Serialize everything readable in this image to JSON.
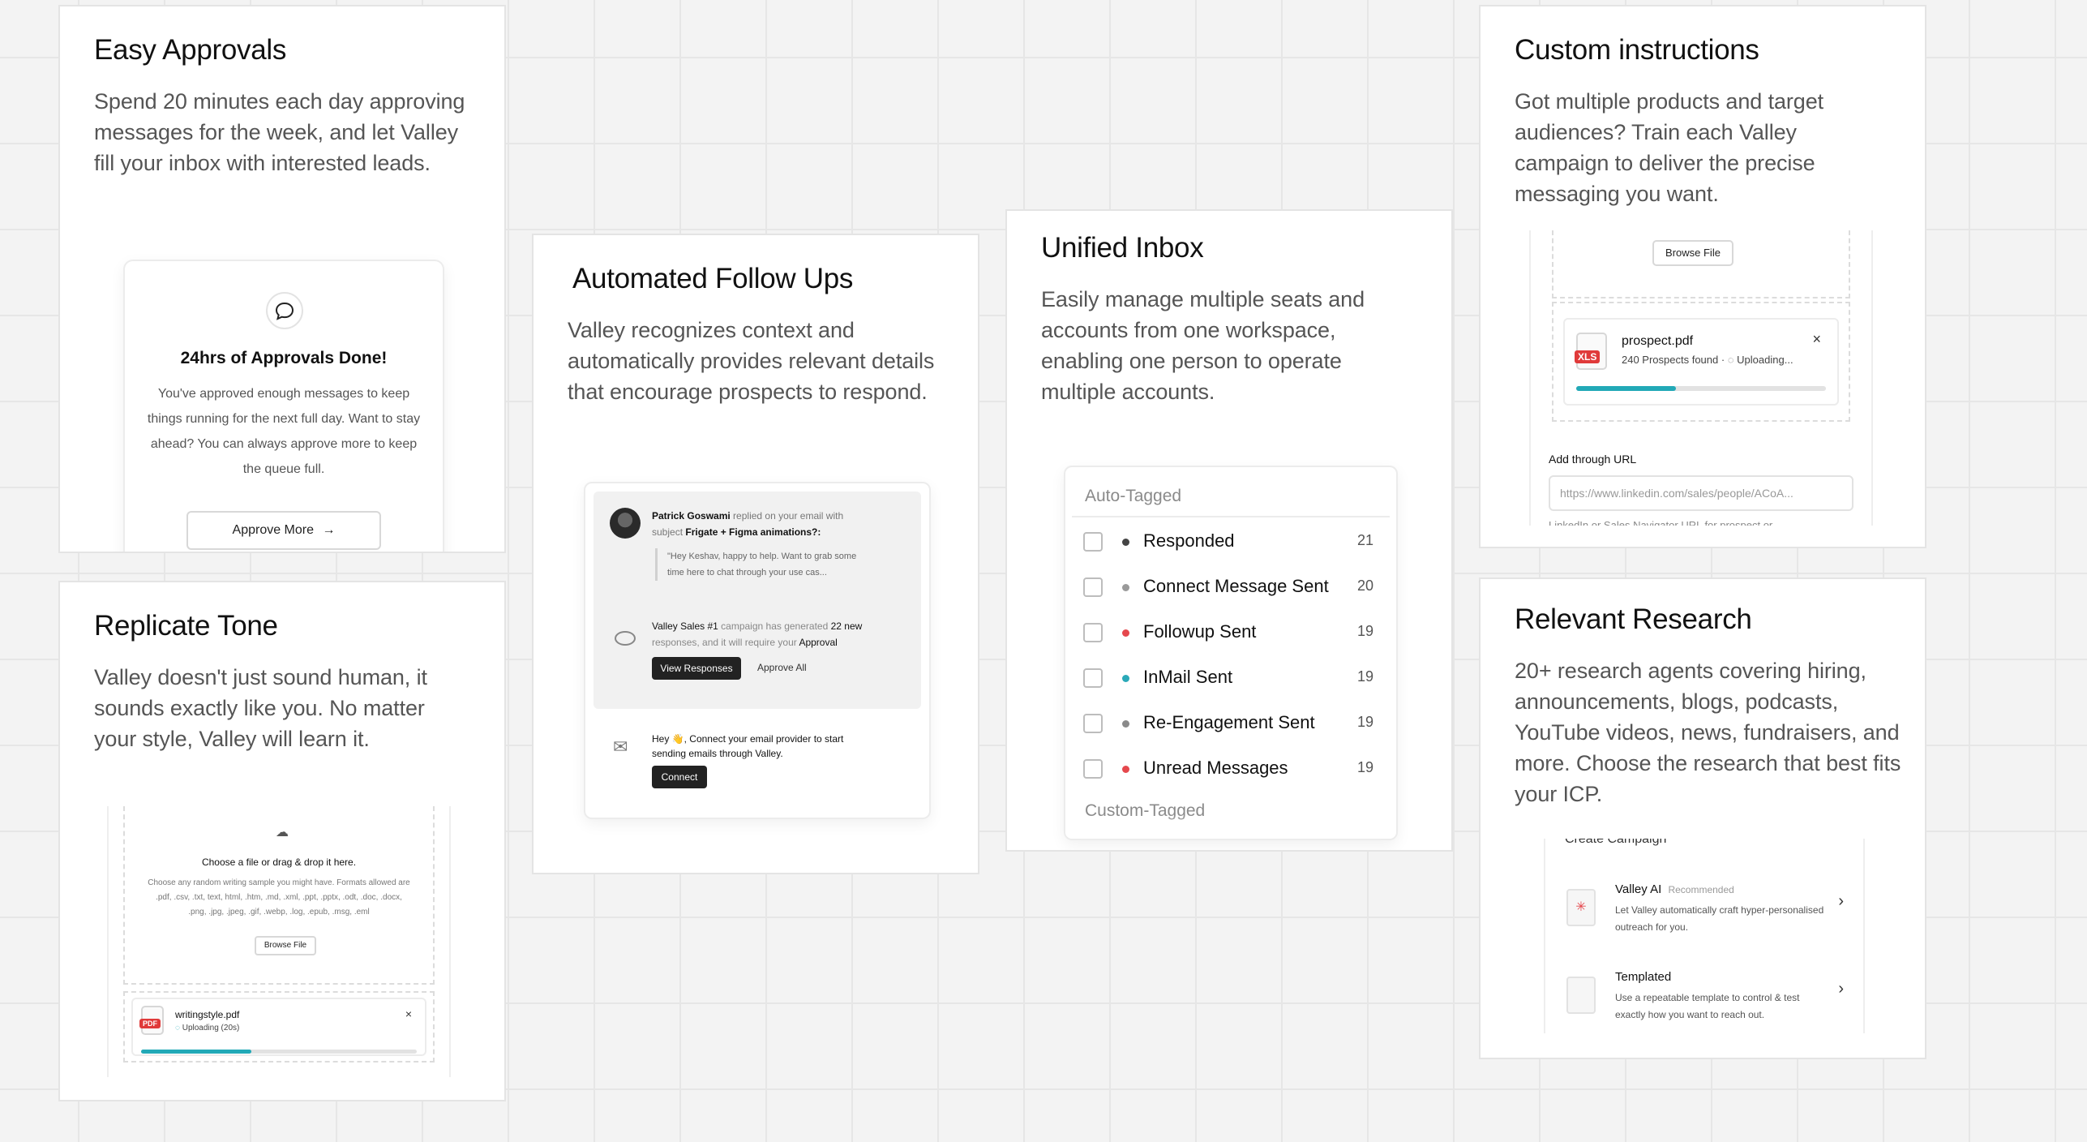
{
  "cards": {
    "easy_approvals": {
      "title": "Easy Approvals",
      "desc": "Spend 20 minutes each day approving messages for the week, and let Valley fill your inbox with interested leads.",
      "mock": {
        "headline": "24hrs of Approvals Done!",
        "body": "You've approved enough messages to keep things running for the next full day. Want to stay ahead? You can always approve more to keep the queue full.",
        "button": "Approve More",
        "icon": "chat-bubble-icon"
      }
    },
    "replicate_tone": {
      "title": "Replicate Tone",
      "desc": "Valley doesn't just sound human, it sounds exactly like you. No matter your style, Valley will learn it.",
      "mock": {
        "upload_title": "Choose a file or drag & drop it here.",
        "upload_hint": "Choose any random writing sample you might have. Formats allowed are .pdf, .csv, .txt, text, html, .htm, .md, .xml, .ppt, .pptx, .odt, .doc, .docx, .png, .jpg, .jpeg, .gif, .webp, .log, .epub, .msg, .eml",
        "browse": "Browse File",
        "file_name": "writingstyle.pdf",
        "file_status": "Uploading (20s)",
        "file_badge": "PDF",
        "progress": 0.4,
        "close": "×"
      }
    },
    "automated_follow_ups": {
      "title": "Automated Follow Ups",
      "desc": "Valley recognizes context and automatically provides relevant details that encourage prospects to respond.",
      "mock": {
        "sender": "Patrick Goswami",
        "notif_1_mid": " replied on your email with subject ",
        "notif_1_subject": "Frigate + Figma animations?:",
        "quote": "\"Hey Keshav, happy to help. Want to grab some time here to chat through your use cas...",
        "campaign_name": "Valley Sales #1",
        "campaign_mid": " campaign has generated ",
        "campaign_count": "22 new",
        "campaign_tail": " responses, and it will require your ",
        "campaign_approval": "Approval",
        "view_responses": "View Responses",
        "approve_all": "Approve All",
        "email_prompt": "Hey 👋, Connect your email provider to start sending emails through Valley.",
        "connect": "Connect"
      }
    },
    "unified_inbox": {
      "title": "Unified Inbox",
      "desc": "Easily manage multiple seats and accounts from one workspace, enabling one person to operate multiple accounts.",
      "mock": {
        "section_auto": "Auto-Tagged",
        "section_custom": "Custom-Tagged",
        "rows": [
          {
            "label": "Responded",
            "count": "21",
            "color": "#444444"
          },
          {
            "label": "Connect Message Sent",
            "count": "20",
            "color": "#9a9a9a"
          },
          {
            "label": "Followup Sent",
            "count": "19",
            "color": "#e5484d"
          },
          {
            "label": "InMail Sent",
            "count": "19",
            "color": "#2aa9b8"
          },
          {
            "label": "Re-Engagement Sent",
            "count": "19",
            "color": "#8a8a8a"
          },
          {
            "label": "Unread Messages",
            "count": "19",
            "color": "#e5484d"
          }
        ]
      }
    },
    "custom_instructions": {
      "title": "Custom instructions",
      "desc": "Got multiple products and target audiences? Train each Valley campaign to deliver the precise messaging you want.",
      "mock": {
        "browse": "Browse File",
        "file_name": "prospect.pdf",
        "file_badge": "XLS",
        "file_meta": "240 Prospects found",
        "file_status": "Uploading...",
        "progress": 0.4,
        "close": "×",
        "url_label": "Add through URL",
        "url_placeholder": "https://www.linkedin.com/sales/people/ACoA...",
        "url_hint": "LinkedIn or Sales Navigator URL for prospect or"
      }
    },
    "relevant_research": {
      "title": "Relevant Research",
      "desc": "20+ research agents covering hiring, announcements, blogs, podcasts, YouTube videos, news, fundraisers, and more. Choose the research that best fits your ICP.",
      "mock": {
        "header": "Create Campaign",
        "options": [
          {
            "title": "Valley AI",
            "tag": "Recommended",
            "desc": "Let Valley automatically craft hyper-personalised outreach for you."
          },
          {
            "title": "Templated",
            "tag": "",
            "desc": "Use a repeatable template to control & test exactly how you want to reach out."
          }
        ]
      }
    }
  },
  "colors": {
    "accent": "#22a9b7",
    "red": "#e5484d",
    "dark_button": "#222222"
  }
}
